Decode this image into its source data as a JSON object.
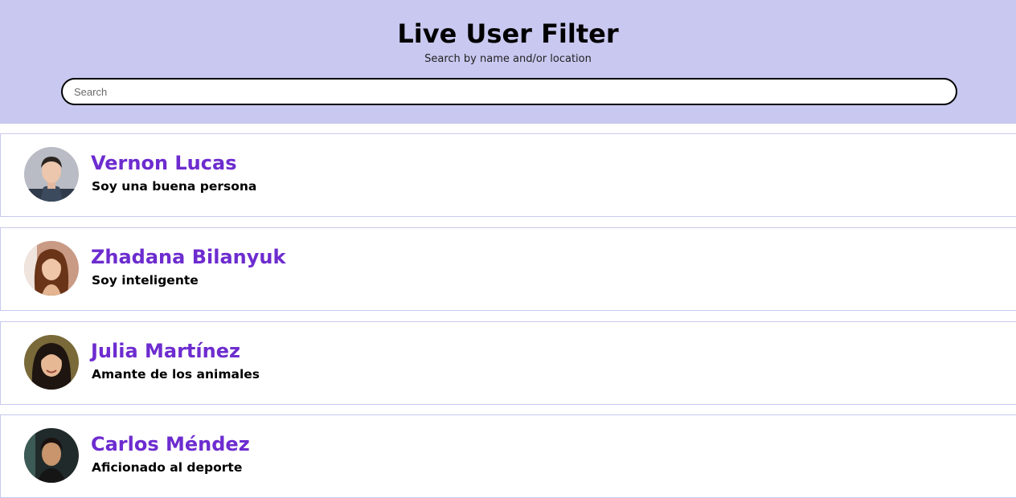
{
  "header": {
    "title": "Live User Filter",
    "subtitle": "Search by name and/or location",
    "search_placeholder": "Search"
  },
  "users": [
    {
      "name": "Vernon Lucas",
      "description": "Soy una buena persona",
      "avatar_icon": "avatar-photo"
    },
    {
      "name": "Zhadana Bilanyuk",
      "description": "Soy inteligente",
      "avatar_icon": "avatar-photo"
    },
    {
      "name": "Julia Martínez",
      "description": "Amante de los animales",
      "avatar_icon": "avatar-photo"
    },
    {
      "name": "Carlos Méndez",
      "description": "Aficionado al deporte",
      "avatar_icon": "avatar-photo"
    }
  ],
  "colors": {
    "header_bg": "#c8c8f0",
    "name_color": "#6d2ccf",
    "card_border": "#c8c8f0"
  }
}
